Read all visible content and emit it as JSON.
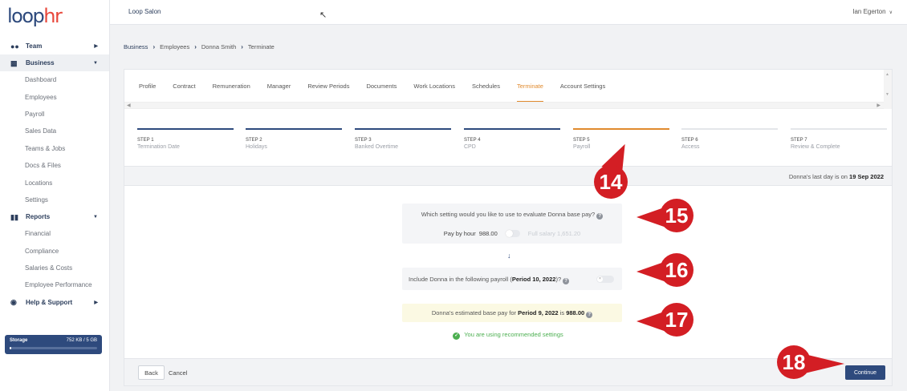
{
  "brand": {
    "logo_main": "loop",
    "logo_accent": "hr"
  },
  "topbar": {
    "org": "Loop Salon",
    "user": "Ian Egerton"
  },
  "sidebar": {
    "sections": [
      {
        "label": "Team",
        "icon": "team-icon"
      },
      {
        "label": "Business",
        "icon": "briefcase-icon"
      }
    ],
    "business_items": [
      "Dashboard",
      "Employees",
      "Payroll",
      "Sales Data",
      "Teams & Jobs",
      "Docs & Files",
      "Locations",
      "Settings"
    ],
    "reports_label": "Reports",
    "reports_items": [
      "Financial",
      "Compliance",
      "Salaries & Costs",
      "Employee Performance"
    ],
    "help_label": "Help & Support",
    "storage": {
      "label": "Storage",
      "value": "752 KB / 5 GB",
      "used_fraction": 0.0001
    }
  },
  "breadcrumb": [
    "Business",
    "Employees",
    "Donna Smith",
    "Terminate"
  ],
  "tabs": [
    "Profile",
    "Contract",
    "Remuneration",
    "Manager",
    "Review Periods",
    "Documents",
    "Work Locations",
    "Schedules",
    "Terminate",
    "Account Settings"
  ],
  "active_tab": "Terminate",
  "steps": [
    {
      "num": "STEP 1",
      "label": "Termination Date"
    },
    {
      "num": "STEP 2",
      "label": "Holidays"
    },
    {
      "num": "STEP 3",
      "label": "Banked Overtime"
    },
    {
      "num": "STEP 4",
      "label": "CPD"
    },
    {
      "num": "STEP 5",
      "label": "Payroll"
    },
    {
      "num": "STEP 6",
      "label": "Access"
    },
    {
      "num": "STEP 7",
      "label": "Review & Complete"
    }
  ],
  "lastday": {
    "prefix": "Donna's last day is on",
    "date": "19 Sep 2022"
  },
  "basepay": {
    "question": "Which setting would you like to use to evaluate Donna base pay?",
    "option_a_label": "Pay by hour",
    "option_a_value": "988.00",
    "option_b_label": "Full salary",
    "option_b_value": "1,651.20"
  },
  "include": {
    "prefix": "Include Donna in the following payroll (",
    "period": "Period 10, 2022",
    "suffix": ")?"
  },
  "estimate": {
    "prefix": "Donna's estimated base pay for",
    "period": "Period 9, 2022",
    "mid": "is",
    "amount": "988.00"
  },
  "recommended": "You are using recommended settings",
  "footer": {
    "back": "Back",
    "cancel": "Cancel",
    "continue": "Continue"
  },
  "callouts": [
    "14",
    "15",
    "16",
    "17",
    "18"
  ],
  "colors": {
    "primary": "#2e4a7d",
    "accent": "#e08a2e",
    "callout": "#d31e24",
    "success": "#4caf50"
  }
}
